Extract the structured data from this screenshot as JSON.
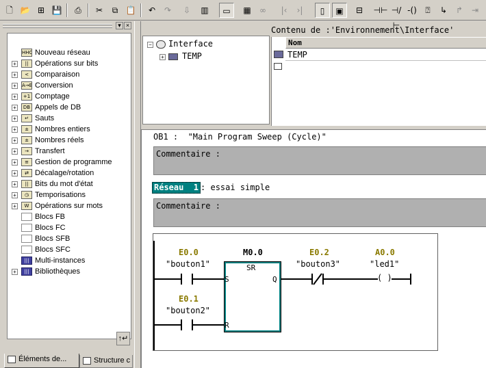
{
  "toolbar": {
    "icons": [
      "new-icon",
      "open-icon",
      "accessible-nodes-icon",
      "save-icon",
      "print-icon",
      "cut-icon",
      "copy-icon",
      "paste-icon",
      "undo-icon",
      "redo-icon",
      "load-icon",
      "monitor-icon",
      "comment-icon",
      "address-icon",
      "overview-icon",
      "prev-icon",
      "next-icon",
      "detail-icon",
      "catalog-icon",
      "network-icon",
      "contact-no-icon",
      "contact-nc-icon",
      "coil-icon",
      "box-icon",
      "branch-open-icon",
      "branch-close-icon",
      "arrow-icon"
    ]
  },
  "left_pane": {
    "items": [
      {
        "label": "Nouveau réseau",
        "icon": "HHO",
        "expand": false
      },
      {
        "label": "Opérations sur bits",
        "icon": "||",
        "expand": true
      },
      {
        "label": "Comparaison",
        "icon": "<",
        "expand": true
      },
      {
        "label": "Conversion",
        "icon": "A→B",
        "expand": true
      },
      {
        "label": "Comptage",
        "icon": "+1",
        "expand": true
      },
      {
        "label": "Appels de DB",
        "icon": "DB",
        "expand": true
      },
      {
        "label": "Sauts",
        "icon": "↵",
        "expand": true
      },
      {
        "label": "Nombres entiers",
        "icon": "±",
        "expand": true
      },
      {
        "label": "Nombres réels",
        "icon": "±",
        "expand": true
      },
      {
        "label": "Transfert",
        "icon": "→",
        "expand": true
      },
      {
        "label": "Gestion de programme",
        "icon": "≡",
        "expand": true
      },
      {
        "label": "Décalage/rotation",
        "icon": "⇄",
        "expand": true
      },
      {
        "label": "Bits du mot d'état",
        "icon": "||",
        "expand": true
      },
      {
        "label": "Temporisations",
        "icon": "◷",
        "expand": true
      },
      {
        "label": "Opérations sur mots",
        "icon": "W",
        "expand": true
      },
      {
        "label": "Blocs FB",
        "icon": "",
        "expand": false
      },
      {
        "label": "Blocs FC",
        "icon": "",
        "expand": false
      },
      {
        "label": "Blocs SFB",
        "icon": "",
        "expand": false
      },
      {
        "label": "Blocs SFC",
        "icon": "",
        "expand": false
      },
      {
        "label": "Multi-instances",
        "icon": "|||",
        "expand": false
      },
      {
        "label": "Bibliothèques",
        "icon": "|||",
        "expand": true
      }
    ],
    "tabs": [
      "Éléments de...",
      "Structure c"
    ],
    "scroll_button": "↑↵"
  },
  "interface": {
    "root": "Interface",
    "child": "TEMP",
    "content_title": "Contenu de :'Environnement\\Interface'",
    "column": "Nom",
    "rows": [
      "TEMP"
    ]
  },
  "code": {
    "ob_title": "OB1 :  \"Main Program Sweep (Cycle)\"",
    "comment_label": "Commentaire :",
    "network_label": "Réseau  1",
    "network_title": ": essai simple",
    "ladder": {
      "contact1_addr": "E0.0",
      "contact1_sym": "\"bouton1\"",
      "contact2_addr": "E0.1",
      "contact2_sym": "\"bouton2\"",
      "box_addr": "M0.0",
      "box_type": "SR",
      "pin_s": "S",
      "pin_r": "R",
      "pin_q": "Q",
      "contact3_addr": "E0.2",
      "contact3_sym": "\"bouton3\"",
      "coil_addr": "A0.0",
      "coil_sym": "\"led1\"",
      "coil_text": "( )"
    }
  }
}
